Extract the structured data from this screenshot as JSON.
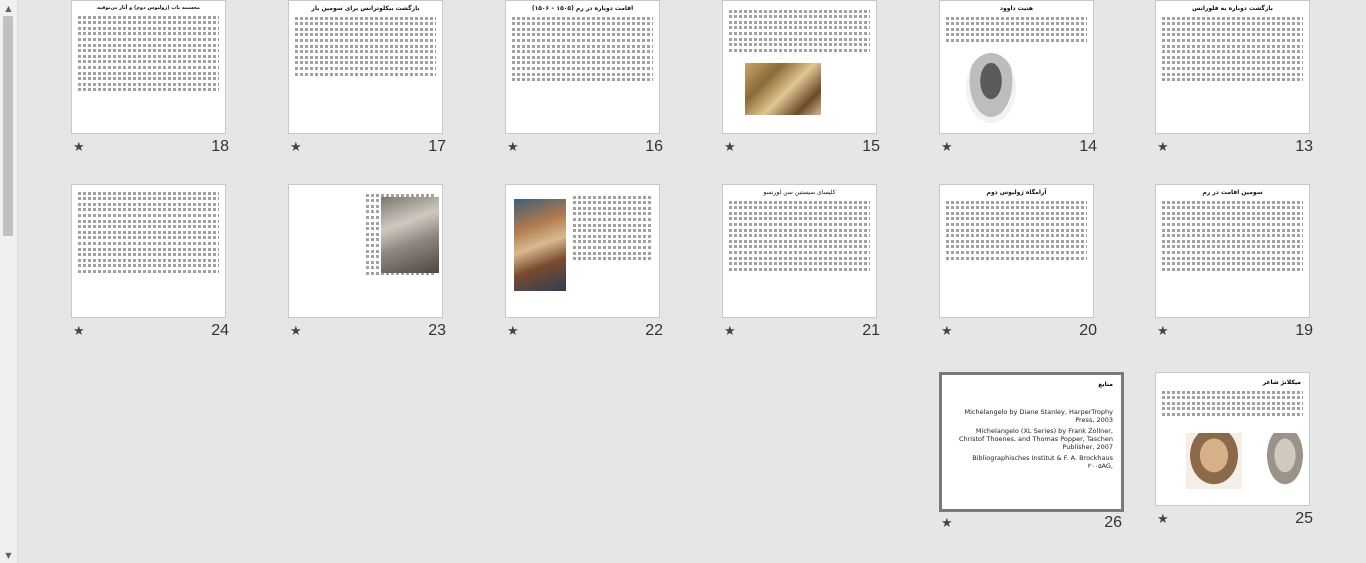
{
  "slides": [
    {
      "number": "13",
      "title": "بازگشت دوباره به فلورانس"
    },
    {
      "number": "14",
      "title": "هنیت داوود"
    },
    {
      "number": "15",
      "title": ""
    },
    {
      "number": "16",
      "title": "اقامت دوباره در رم (۱۵۰۵ – ۱۵۰۶)"
    },
    {
      "number": "17",
      "title": "بازگشت بیکلوترانس برای سومین بار"
    },
    {
      "number": "18",
      "title": "مجسمه پاپ (ژولیوس دوم) و آثار بی‌توقیه"
    },
    {
      "number": "19",
      "title": "سومین اقامت در رم"
    },
    {
      "number": "20",
      "title": "آرامگاه ژولیوس دوم"
    },
    {
      "number": "21",
      "title": "کلیسای سیستین سن لورنسو"
    },
    {
      "number": "22",
      "title": ""
    },
    {
      "number": "23",
      "title": ""
    },
    {
      "number": "24",
      "title": ""
    },
    {
      "number": "25",
      "title": "میکلانژ شاعر"
    },
    {
      "number": "26",
      "title": "منابع"
    }
  ],
  "references": [
    "Michelangelo by Diane Stanley, HarperTrophy Press, 2003",
    "Michelangelo (XL Series) by Frank Zollner, Christof Thoenes, and Thomas Popper, Taschen Publisher, 2007",
    "Bibliographisches Institut & F. A. Brockhaus ۲۰۰۵AG,"
  ],
  "star_icon": "★",
  "scroll": {
    "up_icon": "▲",
    "down_icon": "▼"
  }
}
